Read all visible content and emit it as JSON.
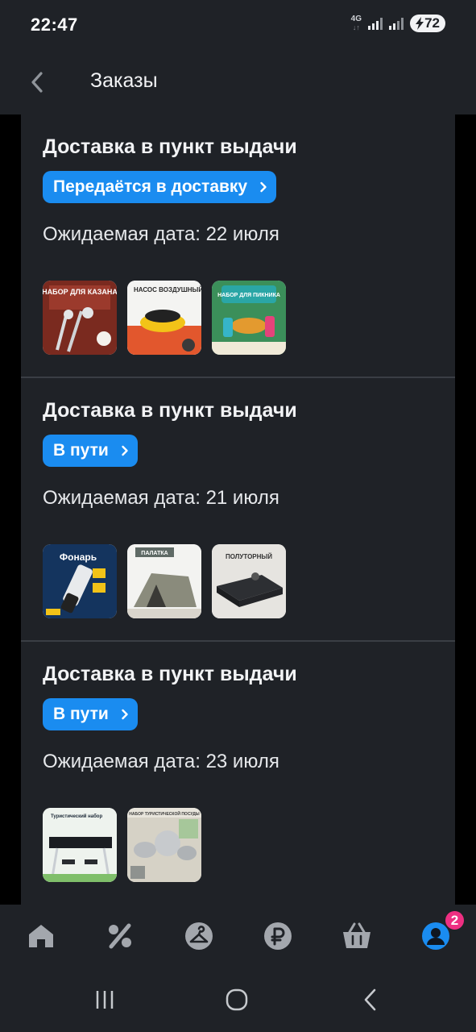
{
  "status_bar": {
    "time": "22:47",
    "network": "4G",
    "battery": "72"
  },
  "header": {
    "title": "Заказы",
    "back_icon": "chevron-left-icon"
  },
  "orders": [
    {
      "title": "Доставка в пункт выдачи",
      "status": "Передаётся в доставку",
      "date": "Ожидаемая дата: 22 июля",
      "items": [
        {
          "caption": "НАБОР ДЛЯ КАЗАНА"
        },
        {
          "caption": "НАСОС ВОЗДУШНЫЙ"
        },
        {
          "caption": "НАБОР ДЛЯ ПИКНИКА"
        }
      ]
    },
    {
      "title": "Доставка в пункт выдачи",
      "status": "В пути",
      "date": "Ожидаемая дата: 21 июля",
      "items": [
        {
          "caption": "Фонарь"
        },
        {
          "caption": "ПАЛАТКА"
        },
        {
          "caption": "ПОЛУТОРНЫЙ"
        }
      ]
    },
    {
      "title": "Доставка в пункт выдачи",
      "status": "В пути",
      "date": "Ожидаемая дата: 23 июля",
      "items": [
        {
          "caption": "Туристический набор"
        },
        {
          "caption": "НАБОР ТУРИСТИЧЕСКОЙ ПОСУДЫ"
        }
      ]
    }
  ],
  "bottom_nav": {
    "items": [
      "home-icon",
      "percent-icon",
      "hanger-icon",
      "ruble-icon",
      "basket-icon",
      "profile-icon"
    ],
    "active": "profile-icon",
    "profile_badge": "2"
  },
  "colors": {
    "accent": "#1a8cf0",
    "badge": "#ee2f82",
    "panel": "#1f2227",
    "icon": "#a3a7ad"
  }
}
